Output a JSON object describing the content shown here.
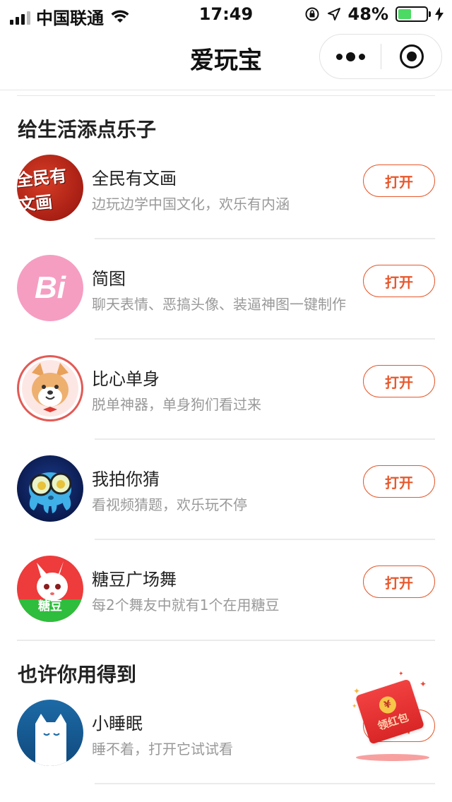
{
  "status_bar": {
    "carrier": "中国联通",
    "time": "17:49",
    "battery_percent": "48%",
    "battery_level": 0.48,
    "battery_color": "#4cd964"
  },
  "nav": {
    "title": "爱玩宝",
    "more_icon": "more-dots-icon",
    "close_icon": "target-close-icon"
  },
  "sections": [
    {
      "title": "给生活添点乐子",
      "apps": [
        {
          "name": "全民有文画",
          "desc": "边玩边学中国文化，欢乐有内涵",
          "button": "打开",
          "icon_text": "全民有文画"
        },
        {
          "name": "简图",
          "desc": "聊天表情、恶搞头像、装逼神图一键制作",
          "button": "打开",
          "icon_text": "Bi"
        },
        {
          "name": "比心单身",
          "desc": "脱单神器，单身狗们看过来",
          "button": "打开"
        },
        {
          "name": "我拍你猜",
          "desc": "看视频猜题，欢乐玩不停",
          "button": "打开"
        },
        {
          "name": "糖豆广场舞",
          "desc": "每2个舞友中就有1个在用糖豆",
          "button": "打开",
          "icon_text": "糖豆"
        }
      ]
    },
    {
      "title": "也许你用得到",
      "apps": [
        {
          "name": "小睡眠",
          "desc": "睡不着，打开它试试看",
          "button": "打开"
        }
      ]
    }
  ],
  "red_packet": {
    "label": "领红包",
    "coin": "¥"
  },
  "colors": {
    "accent": "#e8582c",
    "red_packet": "#e53333"
  }
}
